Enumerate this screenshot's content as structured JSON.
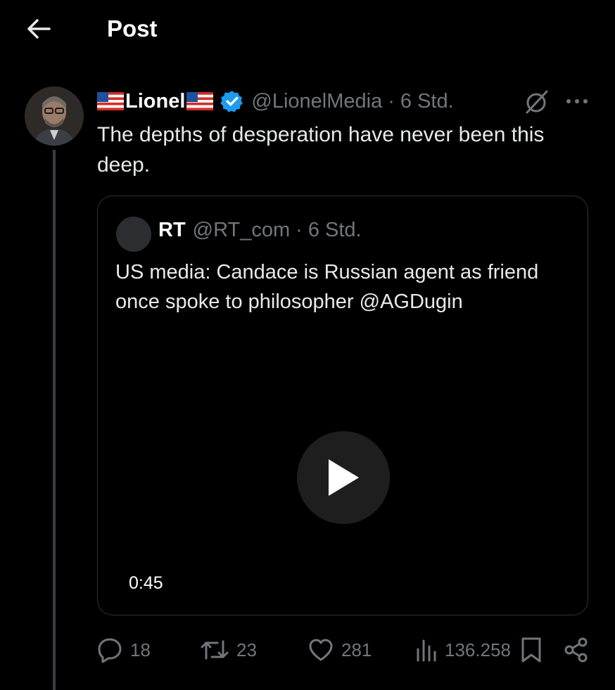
{
  "header": {
    "title": "Post"
  },
  "post": {
    "author_name": "Lionel",
    "handle": "@LionelMedia",
    "separator": "·",
    "time": "6 Std.",
    "text": "The depths of desperation have never been this deep.",
    "quoted": {
      "author_name": "RT",
      "handle": "@RT_com",
      "separator": "·",
      "time": "6 Std.",
      "text": "US media: Candace is Russian agent as friend once spoke to philosopher @AGDugin",
      "video_duration": "0:45"
    }
  },
  "actions": {
    "replies": "18",
    "reposts": "23",
    "likes": "281",
    "views": "136.258"
  },
  "colors": {
    "background": "#000000",
    "text_primary": "#e7e9ea",
    "text_secondary": "#71767b",
    "border": "#2f3336",
    "verified_blue": "#1d9bf0"
  },
  "icons": [
    "back-arrow-icon",
    "us-flag-icon",
    "verified-badge-icon",
    "grok-icon",
    "more-icon",
    "play-icon",
    "reply-icon",
    "repost-icon",
    "like-icon",
    "views-icon",
    "bookmark-icon",
    "share-icon"
  ]
}
